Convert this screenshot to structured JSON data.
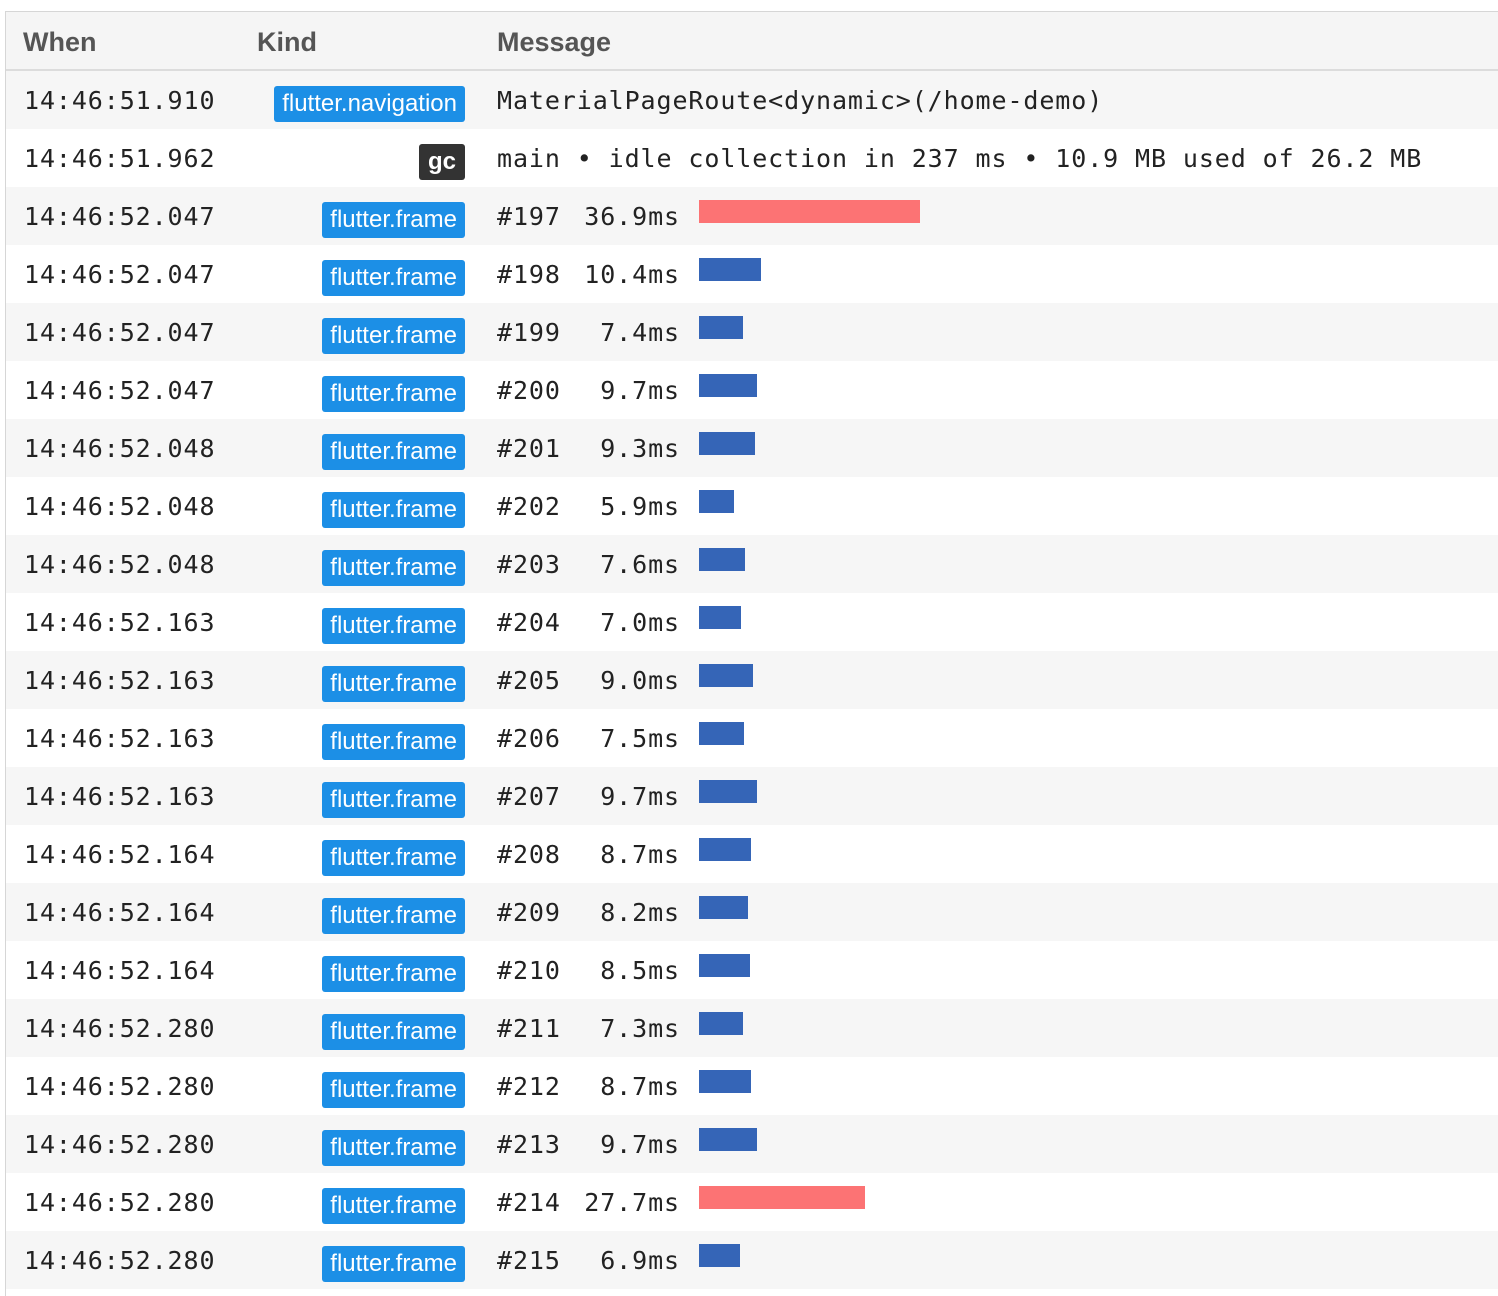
{
  "colors": {
    "badge_blue": "#1c8fe6",
    "badge_dark": "#333333",
    "bar_fast": "#3565b7",
    "bar_slow": "#fc7374"
  },
  "table": {
    "columns": [
      "When",
      "Kind",
      "Message"
    ],
    "rows": [
      {
        "when": "14:46:51.910",
        "kind": "flutter.navigation",
        "kind_style": "blue",
        "message": "MaterialPageRoute<dynamic>(/home-demo)"
      },
      {
        "when": "14:46:51.962",
        "kind": "gc",
        "kind_style": "dark",
        "message": "main • idle collection in 237 ms • 10.9 MB used of 26.2 MB"
      },
      {
        "when": "14:46:52.047",
        "kind": "flutter.frame",
        "kind_style": "blue",
        "frame": "#197",
        "duration": "36.9ms",
        "duration_ms": 36.9,
        "slow": true
      },
      {
        "when": "14:46:52.047",
        "kind": "flutter.frame",
        "kind_style": "blue",
        "frame": "#198",
        "duration": "10.4ms",
        "duration_ms": 10.4,
        "slow": false
      },
      {
        "when": "14:46:52.047",
        "kind": "flutter.frame",
        "kind_style": "blue",
        "frame": "#199",
        "duration": "7.4ms",
        "duration_ms": 7.4,
        "slow": false
      },
      {
        "when": "14:46:52.047",
        "kind": "flutter.frame",
        "kind_style": "blue",
        "frame": "#200",
        "duration": "9.7ms",
        "duration_ms": 9.7,
        "slow": false
      },
      {
        "when": "14:46:52.048",
        "kind": "flutter.frame",
        "kind_style": "blue",
        "frame": "#201",
        "duration": "9.3ms",
        "duration_ms": 9.3,
        "slow": false
      },
      {
        "when": "14:46:52.048",
        "kind": "flutter.frame",
        "kind_style": "blue",
        "frame": "#202",
        "duration": "5.9ms",
        "duration_ms": 5.9,
        "slow": false
      },
      {
        "when": "14:46:52.048",
        "kind": "flutter.frame",
        "kind_style": "blue",
        "frame": "#203",
        "duration": "7.6ms",
        "duration_ms": 7.6,
        "slow": false
      },
      {
        "when": "14:46:52.163",
        "kind": "flutter.frame",
        "kind_style": "blue",
        "frame": "#204",
        "duration": "7.0ms",
        "duration_ms": 7.0,
        "slow": false
      },
      {
        "when": "14:46:52.163",
        "kind": "flutter.frame",
        "kind_style": "blue",
        "frame": "#205",
        "duration": "9.0ms",
        "duration_ms": 9.0,
        "slow": false
      },
      {
        "when": "14:46:52.163",
        "kind": "flutter.frame",
        "kind_style": "blue",
        "frame": "#206",
        "duration": "7.5ms",
        "duration_ms": 7.5,
        "slow": false
      },
      {
        "when": "14:46:52.163",
        "kind": "flutter.frame",
        "kind_style": "blue",
        "frame": "#207",
        "duration": "9.7ms",
        "duration_ms": 9.7,
        "slow": false
      },
      {
        "when": "14:46:52.164",
        "kind": "flutter.frame",
        "kind_style": "blue",
        "frame": "#208",
        "duration": "8.7ms",
        "duration_ms": 8.7,
        "slow": false
      },
      {
        "when": "14:46:52.164",
        "kind": "flutter.frame",
        "kind_style": "blue",
        "frame": "#209",
        "duration": "8.2ms",
        "duration_ms": 8.2,
        "slow": false
      },
      {
        "when": "14:46:52.164",
        "kind": "flutter.frame",
        "kind_style": "blue",
        "frame": "#210",
        "duration": "8.5ms",
        "duration_ms": 8.5,
        "slow": false
      },
      {
        "when": "14:46:52.280",
        "kind": "flutter.frame",
        "kind_style": "blue",
        "frame": "#211",
        "duration": "7.3ms",
        "duration_ms": 7.3,
        "slow": false
      },
      {
        "when": "14:46:52.280",
        "kind": "flutter.frame",
        "kind_style": "blue",
        "frame": "#212",
        "duration": "8.7ms",
        "duration_ms": 8.7,
        "slow": false
      },
      {
        "when": "14:46:52.280",
        "kind": "flutter.frame",
        "kind_style": "blue",
        "frame": "#213",
        "duration": "9.7ms",
        "duration_ms": 9.7,
        "slow": false
      },
      {
        "when": "14:46:52.280",
        "kind": "flutter.frame",
        "kind_style": "blue",
        "frame": "#214",
        "duration": "27.7ms",
        "duration_ms": 27.7,
        "slow": true
      },
      {
        "when": "14:46:52.280",
        "kind": "flutter.frame",
        "kind_style": "blue",
        "frame": "#215",
        "duration": "6.9ms",
        "duration_ms": 6.9,
        "slow": false
      }
    ]
  }
}
